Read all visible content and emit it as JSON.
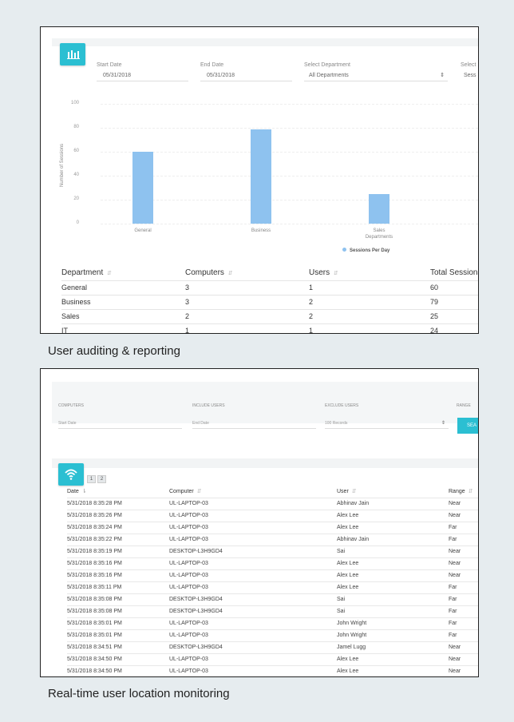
{
  "panel1": {
    "filters": {
      "start_label": "Start Date",
      "start_value": "05/31/2018",
      "end_label": "End Date",
      "end_value": "05/31/2018",
      "dept_label": "Select Department",
      "dept_value": "All Departments",
      "extra_label": "Select",
      "extra_value": "Sess"
    },
    "chart_data": {
      "type": "bar",
      "categories": [
        "General",
        "Business",
        "Sales"
      ],
      "values": [
        60,
        79,
        25
      ],
      "ylabel": "Number of Sessions",
      "xlabel": "Departments",
      "ylim": [
        0,
        100
      ],
      "yticks": [
        "100",
        "80",
        "60",
        "40",
        "20",
        "0"
      ],
      "legend": "Sessions Per Day",
      "bar_color": "#8ec2ef"
    },
    "table": {
      "headers": [
        "Department",
        "Computers",
        "Users",
        "Total Sessions"
      ],
      "sort_icon": "⇵",
      "rows": [
        [
          "General",
          "3",
          "1",
          "60"
        ],
        [
          "Business",
          "3",
          "2",
          "79"
        ],
        [
          "Sales",
          "2",
          "2",
          "25"
        ],
        [
          "IT",
          "1",
          "1",
          "24"
        ]
      ]
    }
  },
  "caption1": "User auditing & reporting",
  "panel2": {
    "filters": {
      "computers_label": "COMPUTERS",
      "computers_value": "Start Date",
      "include_label": "INCLUDE USERS",
      "include_value": "End Date",
      "exclude_label": "EXCLUDE USERS",
      "exclude_value": "100 Records",
      "range_label": "RANGE",
      "search_label": "SEA"
    },
    "pager": [
      "1",
      "2"
    ],
    "table": {
      "headers": [
        "Date",
        "Computer",
        "User",
        "Range"
      ],
      "rows": [
        [
          "5/31/2018 8:35:28 PM",
          "UL-LAPTOP-03",
          "Abhinav Jain",
          "Near"
        ],
        [
          "5/31/2018 8:35:26 PM",
          "UL-LAPTOP-03",
          "Alex Lee",
          "Near"
        ],
        [
          "5/31/2018 8:35:24 PM",
          "UL-LAPTOP-03",
          "Alex Lee",
          "Far"
        ],
        [
          "5/31/2018 8:35:22 PM",
          "UL-LAPTOP-03",
          "Abhinav Jain",
          "Far"
        ],
        [
          "5/31/2018 8:35:19 PM",
          "DESKTOP-L3H9GD4",
          "Sai",
          "Near"
        ],
        [
          "5/31/2018 8:35:16 PM",
          "UL-LAPTOP-03",
          "Alex Lee",
          "Near"
        ],
        [
          "5/31/2018 8:35:16 PM",
          "UL-LAPTOP-03",
          "Alex Lee",
          "Near"
        ],
        [
          "5/31/2018 8:35:11 PM",
          "UL-LAPTOP-03",
          "Alex Lee",
          "Far"
        ],
        [
          "5/31/2018 8:35:08 PM",
          "DESKTOP-L3H9GD4",
          "Sai",
          "Far"
        ],
        [
          "5/31/2018 8:35:08 PM",
          "DESKTOP-L3H9GD4",
          "Sai",
          "Far"
        ],
        [
          "5/31/2018 8:35:01 PM",
          "UL-LAPTOP-03",
          "John Wright",
          "Far"
        ],
        [
          "5/31/2018 8:35:01 PM",
          "UL-LAPTOP-03",
          "John Wright",
          "Far"
        ],
        [
          "5/31/2018 8:34:51 PM",
          "DESKTOP-L3H9GD4",
          "Jamel Lugg",
          "Near"
        ],
        [
          "5/31/2018 8:34:50 PM",
          "UL-LAPTOP-03",
          "Alex Lee",
          "Near"
        ],
        [
          "5/31/2018 8:34:50 PM",
          "UL-LAPTOP-03",
          "Alex Lee",
          "Near"
        ]
      ]
    }
  },
  "caption2": "Real-time user location monitoring",
  "colors": {
    "accent": "#2bbfd2",
    "bar": "#8ec2ef",
    "background": "#e6ecef"
  }
}
